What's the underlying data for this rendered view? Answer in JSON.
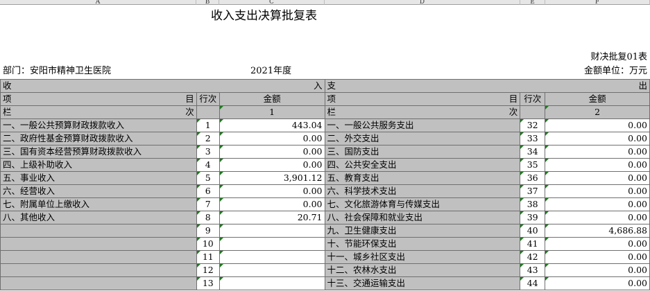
{
  "col_letters": [
    "A",
    "B",
    "C",
    "D",
    "E",
    "F"
  ],
  "title": "收入支出决算批复表",
  "form_code": "财决批复01表",
  "department": "部门：安阳市精神卫生医院",
  "year": "2021年度",
  "unit": "金额单位：万元",
  "header": {
    "income_left": "收",
    "income_right": "入",
    "expense_left": "支",
    "expense_right": "出",
    "item_left": "项",
    "item_right": "目",
    "row_no": "行次",
    "amount": "金额",
    "col_left": "栏",
    "col_right": "次",
    "col_num_income": "1",
    "col_num_expense": "2"
  },
  "rows": [
    {
      "in_name": "一、一般公共预算财政拨款收入",
      "in_no": "1",
      "in_amt": "443.04",
      "ex_name": "一、一般公共服务支出",
      "ex_no": "32",
      "ex_amt": "0.00"
    },
    {
      "in_name": "二、政府性基金预算财政拨款收入",
      "in_no": "2",
      "in_amt": "0.00",
      "ex_name": "二、外交支出",
      "ex_no": "33",
      "ex_amt": "0.00"
    },
    {
      "in_name": "三、国有资本经营预算财政拨款收入",
      "in_no": "3",
      "in_amt": "0.00",
      "ex_name": "三、国防支出",
      "ex_no": "34",
      "ex_amt": "0.00"
    },
    {
      "in_name": "四、上级补助收入",
      "in_no": "4",
      "in_amt": "0.00",
      "ex_name": "四、公共安全支出",
      "ex_no": "35",
      "ex_amt": "0.00"
    },
    {
      "in_name": "五、事业收入",
      "in_no": "5",
      "in_amt": "3,901.12",
      "ex_name": "五、教育支出",
      "ex_no": "36",
      "ex_amt": "0.00"
    },
    {
      "in_name": "六、经营收入",
      "in_no": "6",
      "in_amt": "0.00",
      "ex_name": "六、科学技术支出",
      "ex_no": "37",
      "ex_amt": "0.00"
    },
    {
      "in_name": "七、附属单位上缴收入",
      "in_no": "7",
      "in_amt": "0.00",
      "ex_name": "七、文化旅游体育与传媒支出",
      "ex_no": "38",
      "ex_amt": "0.00"
    },
    {
      "in_name": "八、其他收入",
      "in_no": "8",
      "in_amt": "20.71",
      "ex_name": "八、社会保障和就业支出",
      "ex_no": "39",
      "ex_amt": "0.00"
    },
    {
      "in_name": "",
      "in_no": "9",
      "in_amt": "",
      "ex_name": "九、卫生健康支出",
      "ex_no": "40",
      "ex_amt": "4,686.88"
    },
    {
      "in_name": "",
      "in_no": "10",
      "in_amt": "",
      "ex_name": "十、节能环保支出",
      "ex_no": "41",
      "ex_amt": "0.00"
    },
    {
      "in_name": "",
      "in_no": "11",
      "in_amt": "",
      "ex_name": "十一、城乡社区支出",
      "ex_no": "42",
      "ex_amt": "0.00"
    },
    {
      "in_name": "",
      "in_no": "12",
      "in_amt": "",
      "ex_name": "十二、农林水支出",
      "ex_no": "43",
      "ex_amt": "0.00"
    },
    {
      "in_name": "",
      "in_no": "13",
      "in_amt": "",
      "ex_name": "十三、交通运输支出",
      "ex_no": "44",
      "ex_amt": "0.00"
    }
  ]
}
